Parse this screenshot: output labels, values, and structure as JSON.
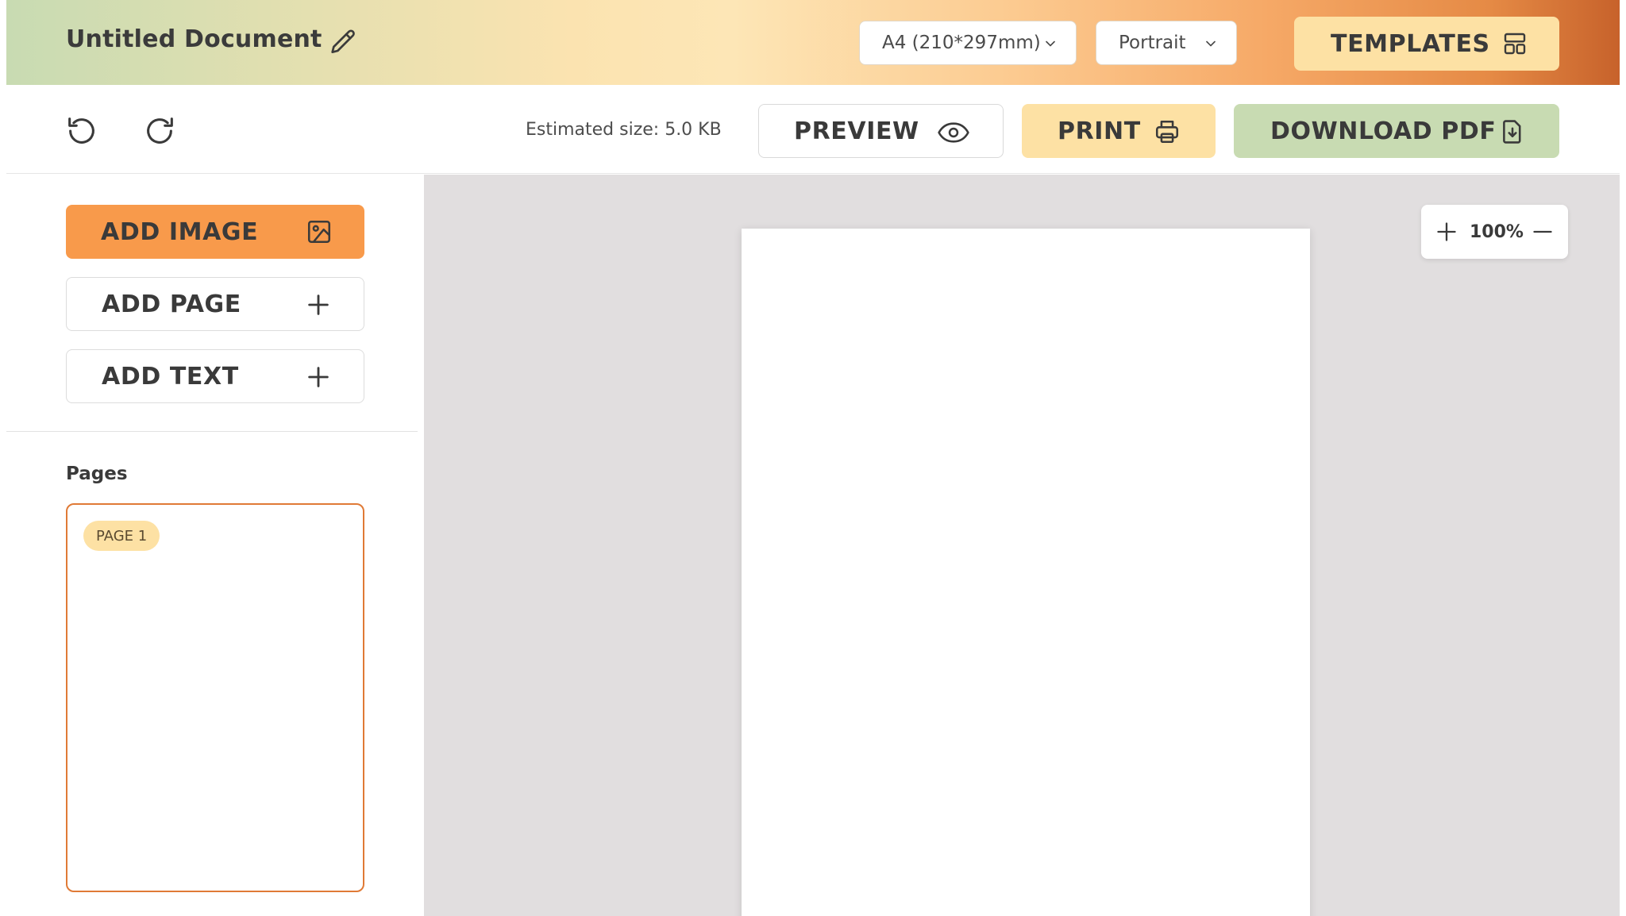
{
  "header": {
    "title": "Untitled Document",
    "page_size": "A4 (210*297mm)",
    "orientation": "Portrait",
    "templates_label": "TEMPLATES"
  },
  "toolbar": {
    "estimated_size": "Estimated size: 5.0 KB",
    "preview_label": "PREVIEW",
    "print_label": "PRINT",
    "download_label": "DOWNLOAD PDF"
  },
  "sidebar": {
    "add_image_label": "ADD IMAGE",
    "add_page_label": "ADD PAGE",
    "add_text_label": "ADD TEXT",
    "pages_heading": "Pages",
    "pages": [
      {
        "badge": "PAGE 1"
      }
    ]
  },
  "canvas": {
    "zoom_level": "100%"
  },
  "colors": {
    "accent_orange": "#f89a4b",
    "accent_yellow": "#fde1a4",
    "accent_green": "#c8dbb2",
    "selected_border": "#e07a36",
    "canvas_bg": "#e1dedf"
  },
  "icons": {
    "edit": "pencil-icon",
    "templates": "layout-icon",
    "undo": "undo-icon",
    "redo": "redo-icon",
    "preview": "eye-icon",
    "print": "printer-icon",
    "download": "file-download-icon",
    "add_image": "image-icon",
    "add": "plus-icon",
    "zoom_in": "plus-icon",
    "zoom_out": "minus-icon"
  }
}
